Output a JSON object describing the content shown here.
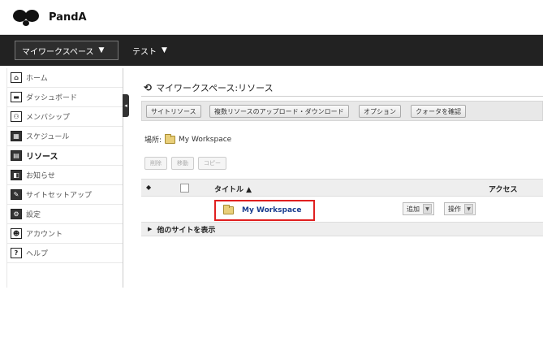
{
  "app": {
    "name": "PandA"
  },
  "nav": {
    "tabs": [
      {
        "label": "マイワークスペース"
      },
      {
        "label": "テスト"
      }
    ],
    "chevron": "▼"
  },
  "sidebar": {
    "items": [
      {
        "label": "ホーム",
        "icon": "home-icon",
        "glyph": "⌂"
      },
      {
        "label": "ダッシュボード",
        "icon": "dashboard-icon",
        "glyph": "▬"
      },
      {
        "label": "メンバシップ",
        "icon": "membership-icon",
        "glyph": "⚇"
      },
      {
        "label": "スケジュール",
        "icon": "calendar-icon",
        "glyph": "▦"
      },
      {
        "label": "リソース",
        "icon": "resources-icon",
        "glyph": "▤",
        "active": true
      },
      {
        "label": "お知らせ",
        "icon": "announcements-icon",
        "glyph": "◧"
      },
      {
        "label": "サイトセットアップ",
        "icon": "site-setup-icon",
        "glyph": "✎"
      },
      {
        "label": "設定",
        "icon": "settings-icon",
        "glyph": "⚙"
      },
      {
        "label": "アカウント",
        "icon": "account-icon",
        "glyph": "☻"
      },
      {
        "label": "ヘルプ",
        "icon": "help-icon",
        "glyph": "?"
      }
    ],
    "collapse_glyph": "◂"
  },
  "main": {
    "title": "マイワークスペース:リソース",
    "title_glyph": "⟲",
    "toolbar": [
      "サイトリソース",
      "複数リソースのアップロード・ダウンロード",
      "オプション",
      "クォータを確認"
    ],
    "location_label": "場所:",
    "location_value": "My Workspace",
    "actions": [
      "削除",
      "移動",
      "コピー"
    ],
    "table": {
      "sort_glyph": "◆",
      "col_title": "タイトル ▲",
      "col_access": "アクセス",
      "rows": [
        {
          "title": "My Workspace",
          "add_label": "追加",
          "actions_label": "操作"
        }
      ]
    },
    "show_other_sites": "他のサイトを表示",
    "show_other_glyph": "▶",
    "caret_glyph": "▼"
  },
  "highlight_color": "#e02020"
}
